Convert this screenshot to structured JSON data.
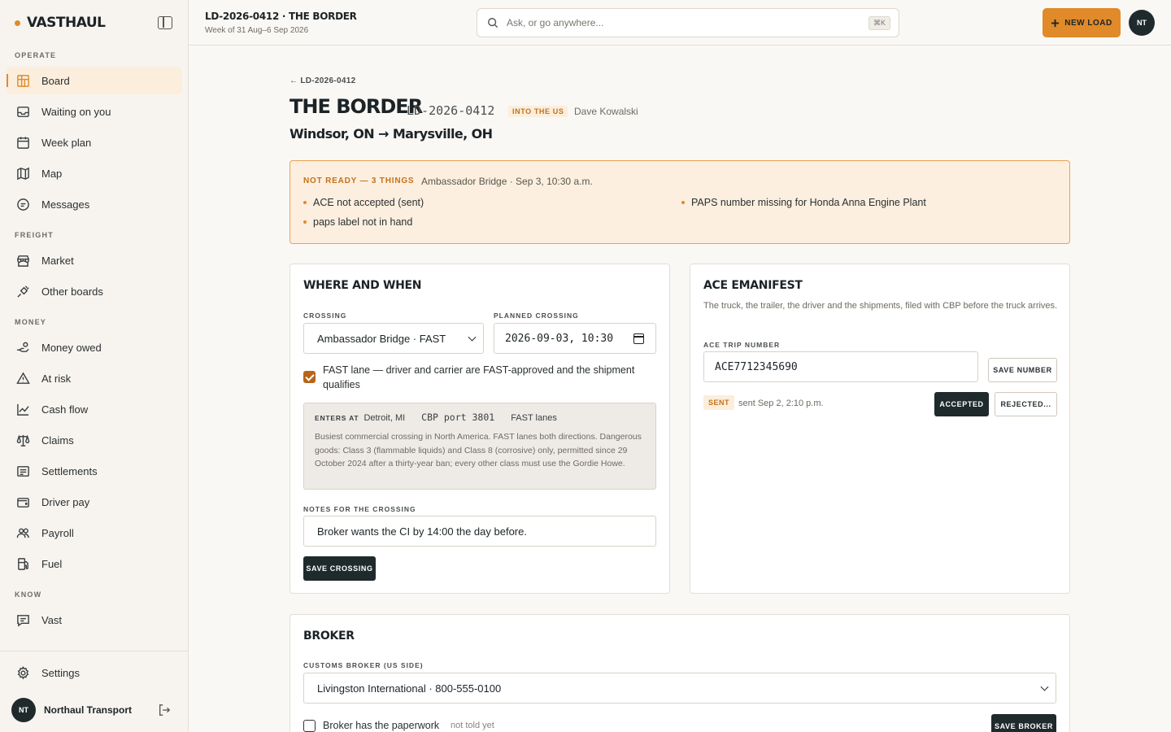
{
  "brand": {
    "name": "VASTHAUL"
  },
  "sidebar": {
    "sections": [
      {
        "label": "OPERATE"
      },
      {
        "label": "FREIGHT"
      },
      {
        "label": "MONEY"
      },
      {
        "label": "KNOW"
      }
    ],
    "items": [
      {
        "label": "Board",
        "icon": "board-icon"
      },
      {
        "label": "Waiting on you",
        "icon": "inbox-icon"
      },
      {
        "label": "Week plan",
        "icon": "calendar-icon"
      },
      {
        "label": "Map",
        "icon": "map-icon"
      },
      {
        "label": "Messages",
        "icon": "message-icon"
      },
      {
        "label": "Market",
        "icon": "store-icon"
      },
      {
        "label": "Other boards",
        "icon": "plug-icon"
      },
      {
        "label": "Money owed",
        "icon": "hand-coins-icon"
      },
      {
        "label": "At risk",
        "icon": "warning-icon"
      },
      {
        "label": "Cash flow",
        "icon": "trend-icon"
      },
      {
        "label": "Claims",
        "icon": "scale-icon"
      },
      {
        "label": "Settlements",
        "icon": "receipt-icon"
      },
      {
        "label": "Driver pay",
        "icon": "wallet-icon"
      },
      {
        "label": "Payroll",
        "icon": "users-icon"
      },
      {
        "label": "Fuel",
        "icon": "fuel-icon"
      },
      {
        "label": "Vast",
        "icon": "chat-icon"
      }
    ],
    "settings_label": "Settings",
    "org": {
      "initials": "NT",
      "name": "Northaul Transport"
    }
  },
  "topbar": {
    "title": "LD-2026-0412 · THE BORDER",
    "subtitle": "Week of 31 Aug–6 Sep 2026",
    "search_placeholder": "Ask, or go anywhere...",
    "shortcut": "⌘K",
    "new_load_label": "NEW LOAD",
    "user_initials": "NT"
  },
  "load": {
    "back_label": "← LD-2026-0412",
    "title": "THE BORDER",
    "id": "LD-2026-0412",
    "direction": "INTO THE US",
    "driver": "Dave Kowalski",
    "route": "Windsor, ON → Marysville, OH"
  },
  "alert": {
    "heading": "NOT READY — 3 THINGS",
    "where_when": "Ambassador Bridge · Sep 3, 10:30 a.m.",
    "items": [
      "ACE not accepted (sent)",
      "PAPS number missing for Honda Anna Engine Plant",
      "paps label not in hand"
    ]
  },
  "where_when": {
    "title": "WHERE AND WHEN",
    "crossing_label": "CROSSING",
    "crossing_value": "Ambassador Bridge · FAST",
    "planned_label": "PLANNED CROSSING",
    "planned_value": "2026-09-03, 10:30",
    "fast_lane_label": "FAST lane — driver and carrier are FAST-approved and the shipment qualifies",
    "fast_lane_checked": true,
    "port": {
      "enters_label": "ENTERS AT",
      "enters_value": "Detroit, MI",
      "cbp_port": "CBP port 3801",
      "lanes": "FAST lanes",
      "description": "Busiest commercial crossing in North America. FAST lanes both directions. Dangerous goods: Class 3 (flammable liquids) and Class 8 (corrosive) only, permitted since 29 October 2024 after a thirty-year ban; every other class must use the Gordie Howe."
    },
    "notes_label": "NOTES FOR THE CROSSING",
    "notes_value": "Broker wants the CI by 14:00 the day before.",
    "save_label": "SAVE CROSSING"
  },
  "ace": {
    "title": "ACE EMANIFEST",
    "description": "The truck, the trailer, the driver and the shipments, filed with CBP before the truck arrives.",
    "trip_label": "ACE TRIP NUMBER",
    "trip_value": "ACE7712345690",
    "save_label": "SAVE NUMBER",
    "status_badge": "SENT",
    "status_text": "sent Sep 2, 2:10 p.m.",
    "accepted_label": "ACCEPTED",
    "rejected_label": "REJECTED..."
  },
  "broker": {
    "title": "BROKER",
    "customs_label": "CUSTOMS BROKER (US SIDE)",
    "customs_value": "Livingston International · 800-555-0100",
    "paperwork_label": "Broker has the paperwork",
    "paperwork_checked": false,
    "paperwork_status": "not told yet",
    "save_label": "SAVE BROKER"
  },
  "colors": {
    "accent": "#e08a2a",
    "dark": "#1f2a2d",
    "alert_bg": "#fcefdf",
    "alert_border": "#e9a153"
  }
}
